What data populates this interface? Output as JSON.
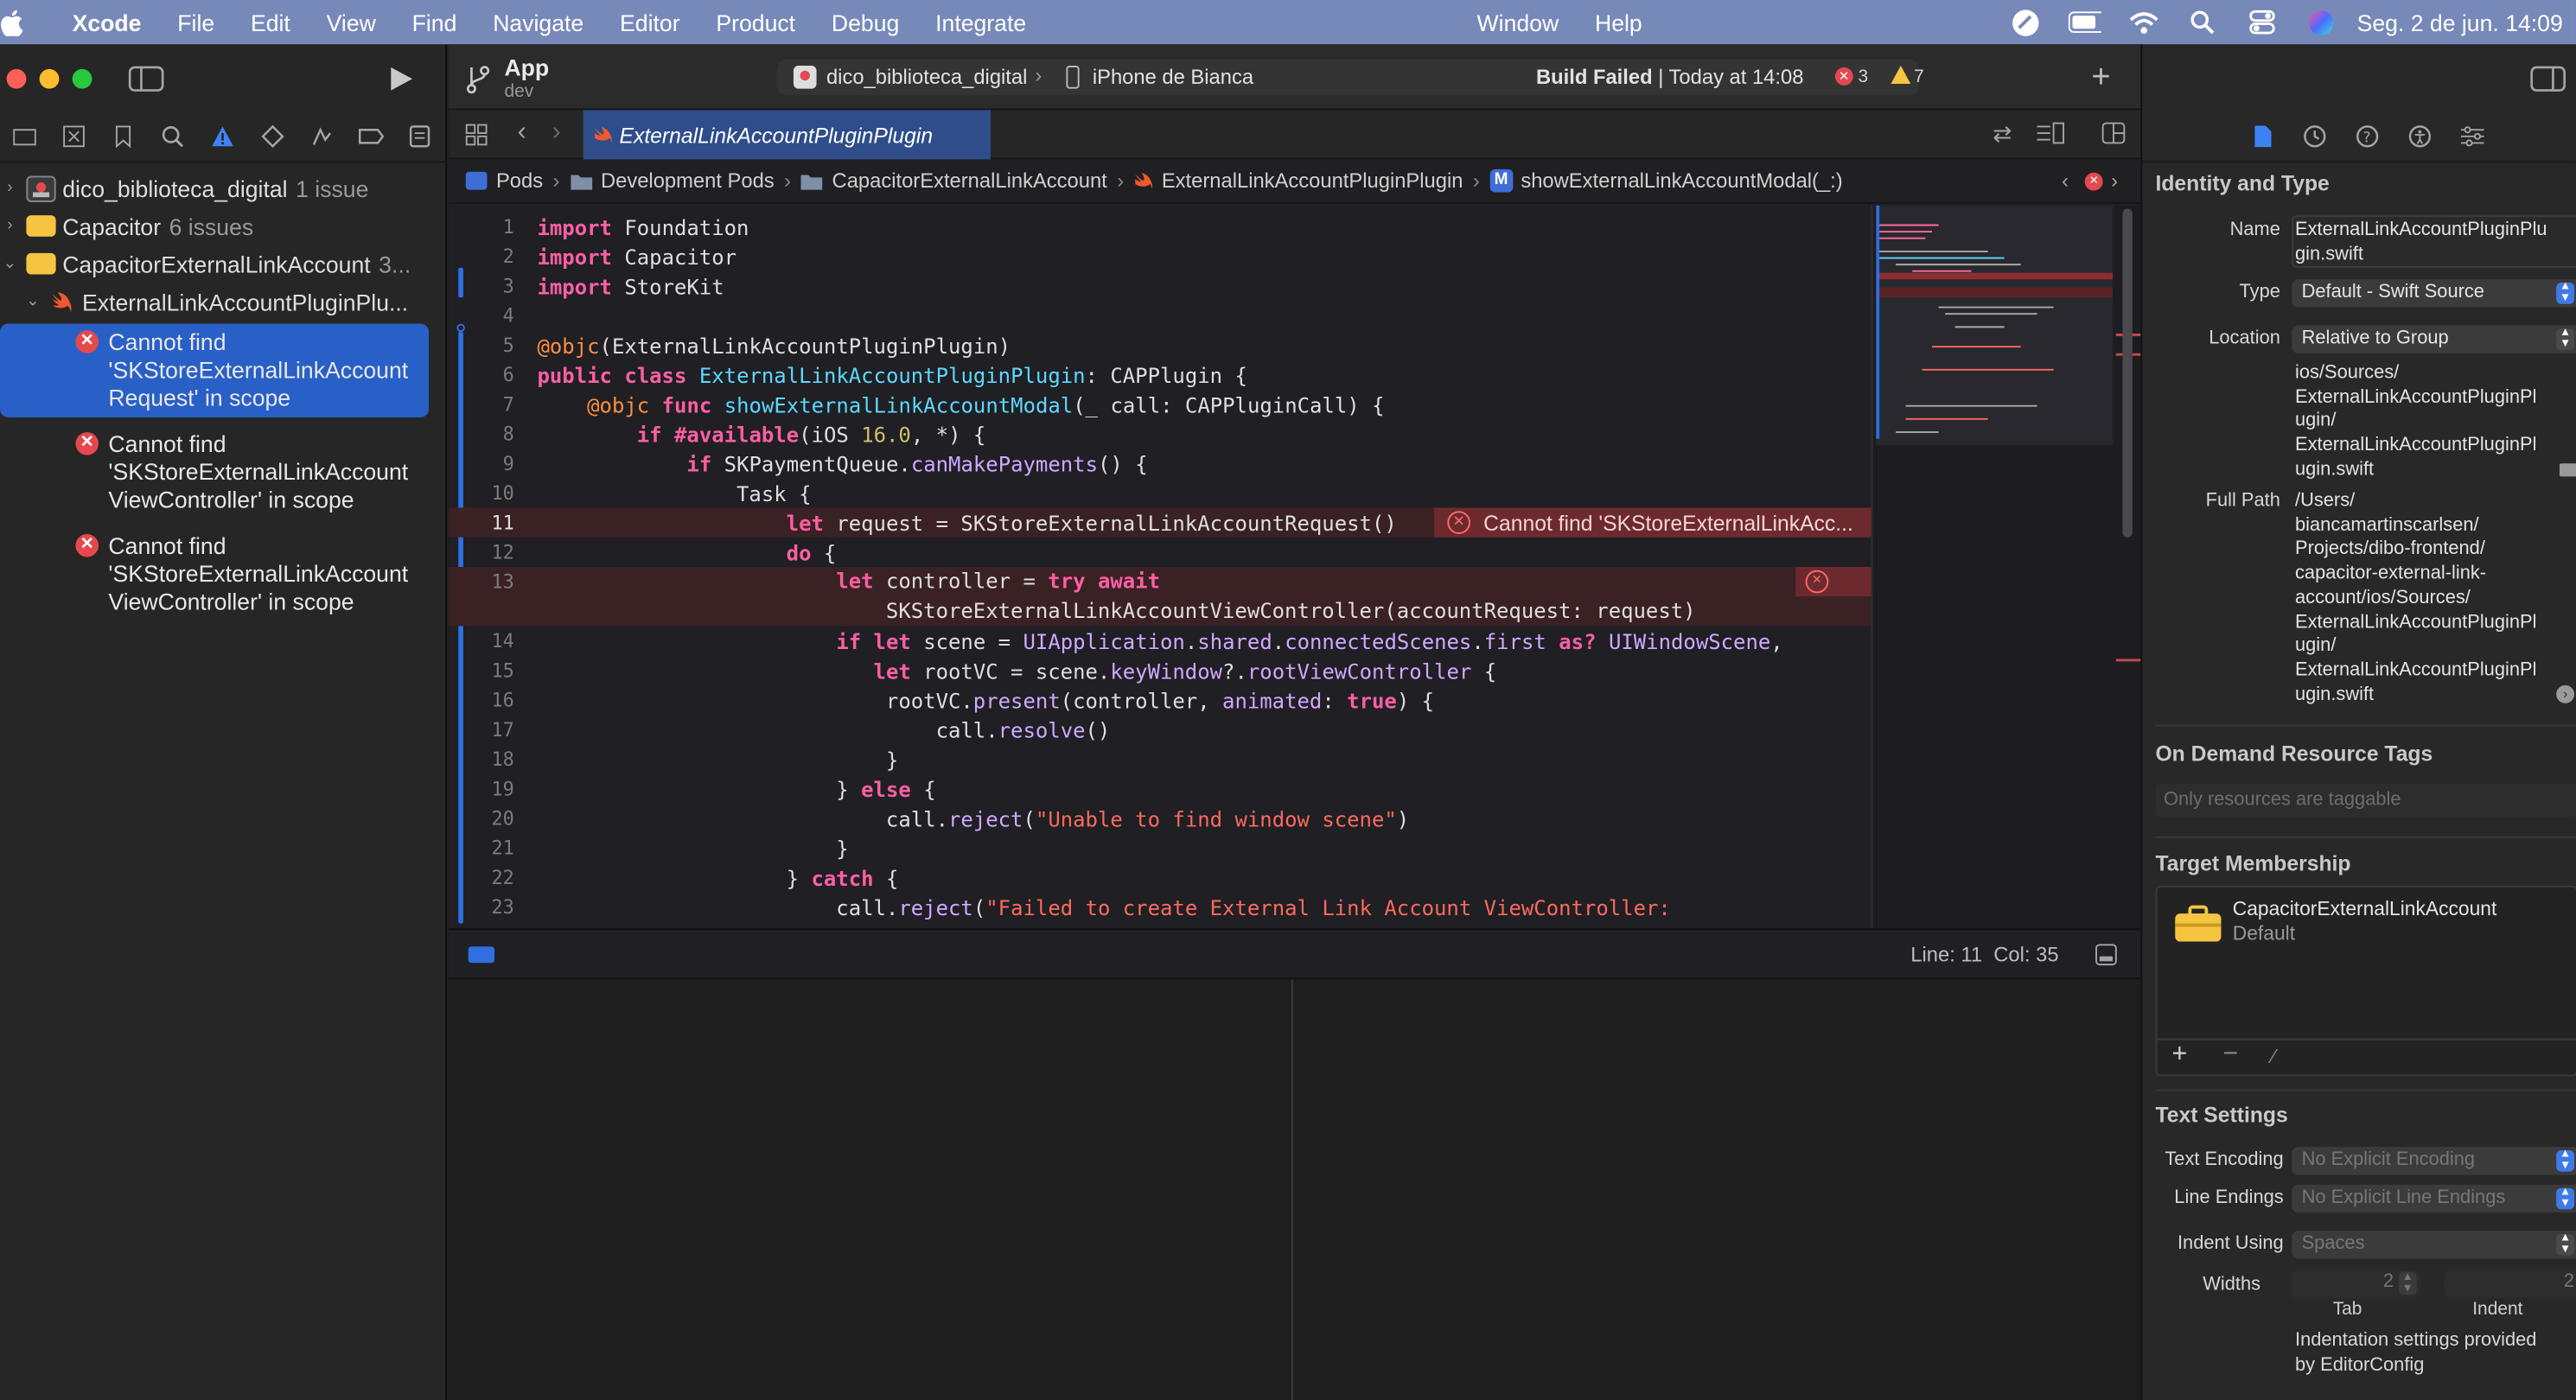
{
  "menubar": {
    "app_name": "Xcode",
    "items": [
      "File",
      "Edit",
      "View",
      "Find",
      "Navigate",
      "Editor",
      "Product",
      "Debug",
      "Integrate"
    ],
    "window_items": [
      "Window",
      "Help"
    ],
    "clock": "Seg. 2 de jun.  14:09"
  },
  "toolbar": {
    "scheme_name": "App",
    "branch": "dev",
    "project": "dico_biblioteca_digital",
    "device": "iPhone de Bianca",
    "status_bold": "Build Failed",
    "status_rest": " | Today at 14:08",
    "error_count": "3",
    "warning_count": "7"
  },
  "navigator": {
    "tree": [
      {
        "label": "dico_biblioteca_digital",
        "count": "1 issue"
      },
      {
        "label": "Capacitor",
        "count": "6 issues"
      },
      {
        "label": "CapacitorExternalLinkAccount",
        "count": "3..."
      },
      {
        "label": "ExternalLinkAccountPluginPlu...",
        "count": ""
      }
    ],
    "issues": [
      {
        "l1": "Cannot find",
        "l2": "'SKStoreExternalLinkAccount",
        "l3": "Request' in scope"
      },
      {
        "l1": "Cannot find",
        "l2": "'SKStoreExternalLinkAccount",
        "l3": "ViewController' in scope"
      },
      {
        "l1": "Cannot find",
        "l2": "'SKStoreExternalLinkAccount",
        "l3": "ViewController' in scope"
      }
    ]
  },
  "tab": {
    "label": "ExternalLinkAccountPluginPlugin"
  },
  "jumpbar": [
    "Pods",
    "Development Pods",
    "CapacitorExternalLinkAccount",
    "ExternalLinkAccountPluginPlugin",
    "showExternalLinkAccountModal(_:)"
  ],
  "code": {
    "lines": [
      "1",
      "2",
      "3",
      "4",
      "5",
      "6",
      "7",
      "8",
      "9",
      "10",
      "11",
      "12",
      "13",
      "",
      "14",
      "15",
      "16",
      "17",
      "18",
      "19",
      "20",
      "21",
      "22",
      "23"
    ],
    "error_message": "Cannot find 'SKStoreExternalLinkAcc..."
  },
  "status": {
    "position": "Line: 11  Col: 35"
  },
  "inspector": {
    "identity_title": "Identity and Type",
    "name_label": "Name",
    "name_value": [
      "ExternalLinkAccountPluginPlu",
      "gin.swift"
    ],
    "type_label": "Type",
    "type_value": "Default - Swift Source",
    "location_label": "Location",
    "location_value": "Relative to Group",
    "location_path": [
      "ios/Sources/",
      "ExternalLinkAccountPluginPl",
      "ugin/",
      "ExternalLinkAccountPluginPl",
      "ugin.swift"
    ],
    "full_path_label": "Full Path",
    "full_path": [
      "/Users/",
      "biancamartinscarlsen/",
      "Projects/dibo-frontend/",
      "capacitor-external-link-",
      "account/ios/Sources/",
      "ExternalLinkAccountPluginPl",
      "ugin/",
      "ExternalLinkAccountPluginPl",
      "ugin.swift"
    ],
    "on_demand_title": "On Demand Resource Tags",
    "on_demand_placeholder": "Only resources are taggable",
    "target_title": "Target Membership",
    "target_name": "CapacitorExternalLinkAccount",
    "target_sub": "Default",
    "text_settings_title": "Text Settings",
    "encoding_label": "Text Encoding",
    "encoding_value": "No Explicit Encoding",
    "line_endings_label": "Line Endings",
    "line_endings_value": "No Explicit Line Endings",
    "indent_label": "Indent Using",
    "indent_value": "Spaces",
    "widths_label": "Widths",
    "tab_width": "2",
    "indent_width": "2",
    "tab_label": "Tab",
    "indent_sub_label": "Indent",
    "editorconfig_note": [
      "Indentation settings provided",
      "by EditorConfig"
    ]
  },
  "colors": {
    "accent": "#2960c7",
    "error": "#e5484d",
    "warning": "#f5c542",
    "menubar": "#7789b9"
  }
}
